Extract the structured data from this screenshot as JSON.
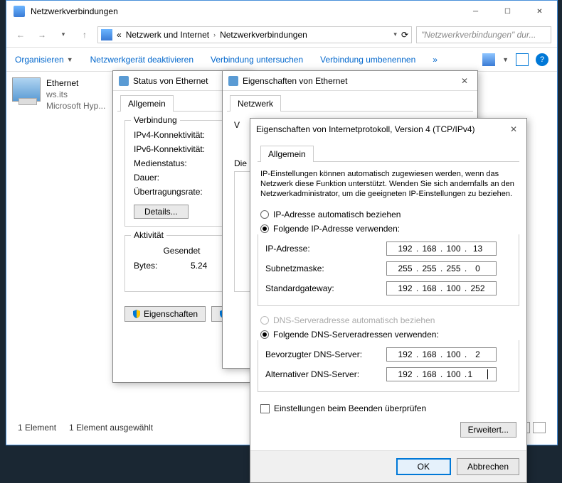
{
  "explorer": {
    "title": "Netzwerkverbindungen",
    "breadcrumb_prefix": "«",
    "breadcrumb_1": "Netzwerk und Internet",
    "breadcrumb_2": "Netzwerkverbindungen",
    "search_placeholder": "\"Netzwerkverbindungen\" dur...",
    "toolbar": {
      "organize": "Organisieren",
      "disable": "Netzwerkgerät deaktivieren",
      "diagnose": "Verbindung untersuchen",
      "rename": "Verbindung umbenennen",
      "more": "»"
    },
    "item": {
      "name": "Ethernet",
      "sub1": "ws.its",
      "sub2": "Microsoft Hyp..."
    },
    "status_left": "1 Element",
    "status_selected": "1 Element ausgewählt"
  },
  "status_dlg": {
    "title": "Status von Ethernet",
    "tab_general": "Allgemein",
    "group_conn": "Verbindung",
    "ipv4": "IPv4-Konnektivität:",
    "ipv6": "IPv6-Konnektivität:",
    "media": "Medienstatus:",
    "duration": "Dauer:",
    "speed": "Übertragungsrate:",
    "details_btn": "Details...",
    "group_activity": "Aktivität",
    "sent": "Gesendet",
    "bytes": "Bytes:",
    "bytes_val": "5.24",
    "props_btn": "Eigenschaften"
  },
  "eth_props": {
    "title": "Eigenschaften von Ethernet",
    "tab_network": "Netzwerk",
    "conn_text": "V",
    "section": "Die"
  },
  "tcpip": {
    "title": "Eigenschaften von Internetprotokoll, Version 4 (TCP/IPv4)",
    "tab_general": "Allgemein",
    "desc": "IP-Einstellungen können automatisch zugewiesen werden, wenn das Netzwerk diese Funktion unterstützt. Wenden Sie sich andernfalls an den Netzwerkadministrator, um die geeigneten IP-Einstellungen zu beziehen.",
    "radio_auto_ip": "IP-Adresse automatisch beziehen",
    "radio_manual_ip": "Folgende IP-Adresse verwenden:",
    "ip_label": "IP-Adresse:",
    "subnet_label": "Subnetzmaske:",
    "gateway_label": "Standardgateway:",
    "ip_addr": {
      "a": "192",
      "b": "168",
      "c": "100",
      "d": "13"
    },
    "subnet": {
      "a": "255",
      "b": "255",
      "c": "255",
      "d": "0"
    },
    "gateway": {
      "a": "192",
      "b": "168",
      "c": "100",
      "d": "252"
    },
    "radio_auto_dns": "DNS-Serveradresse automatisch beziehen",
    "radio_manual_dns": "Folgende DNS-Serveradressen verwenden:",
    "dns1_label": "Bevorzugter DNS-Server:",
    "dns2_label": "Alternativer DNS-Server:",
    "dns1": {
      "a": "192",
      "b": "168",
      "c": "100",
      "d": "2"
    },
    "dns2": {
      "a": "192",
      "b": "168",
      "c": "100",
      "d": "1"
    },
    "check_validate": "Einstellungen beim Beenden überprüfen",
    "advanced_btn": "Erweitert...",
    "ok": "OK",
    "cancel": "Abbrechen"
  }
}
